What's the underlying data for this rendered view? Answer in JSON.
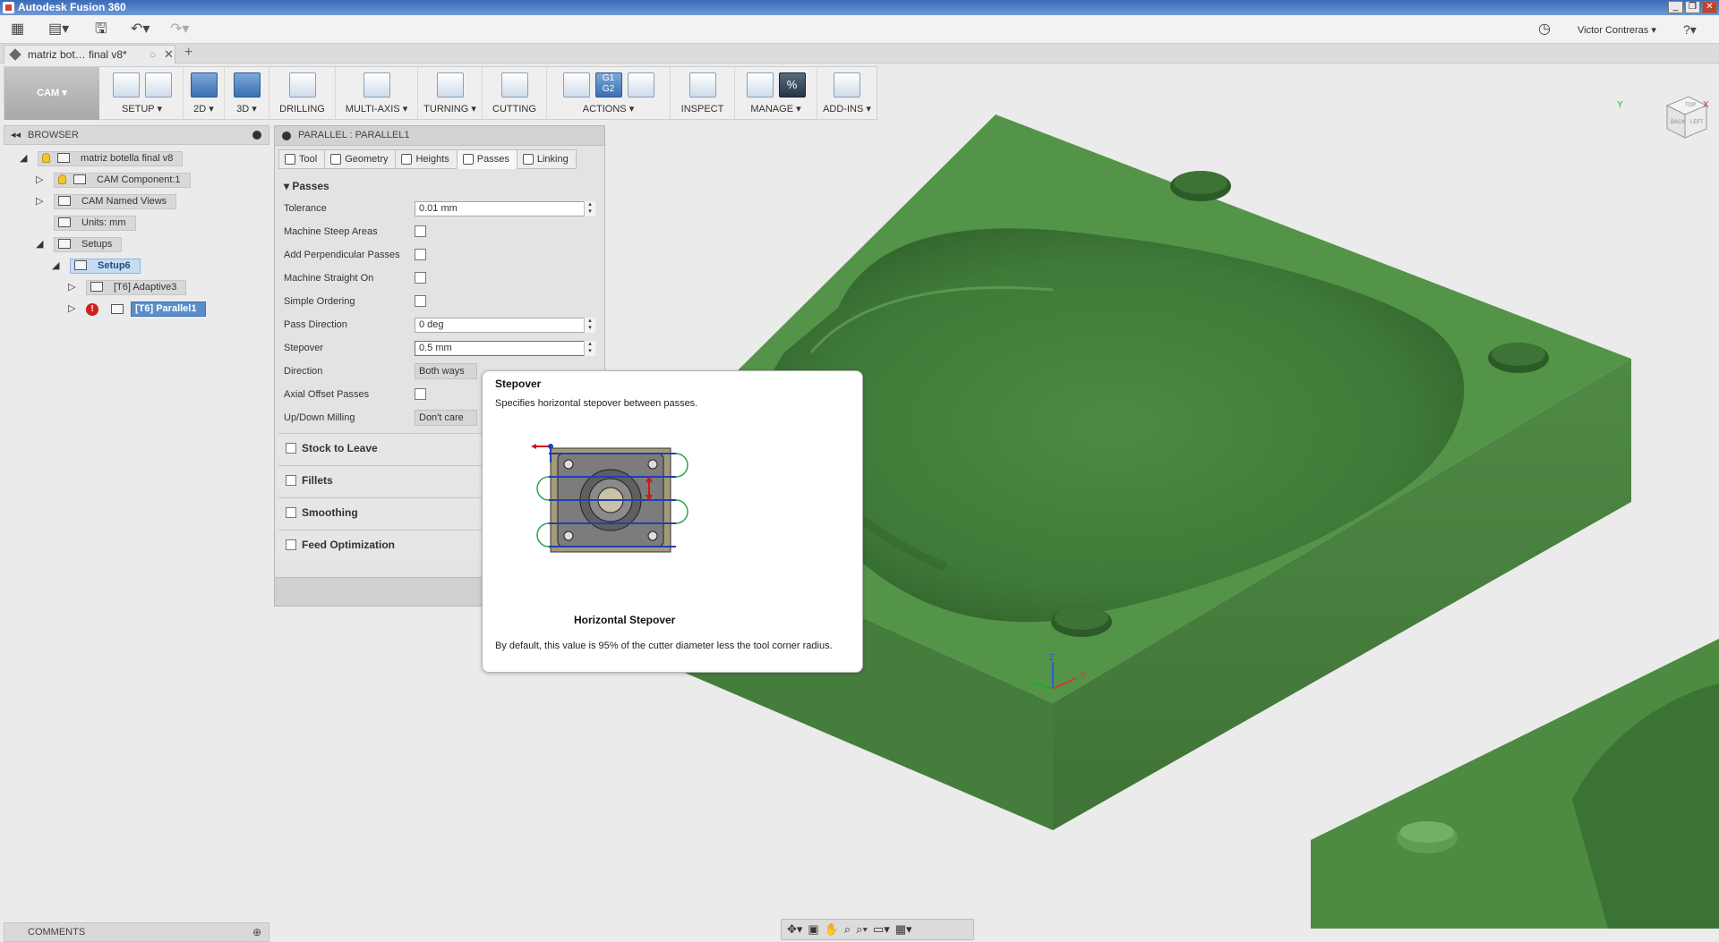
{
  "window": {
    "title": "Autodesk Fusion 360"
  },
  "qat": {
    "user_name": "Victor Contreras",
    "help": "?"
  },
  "document_tab": {
    "title": "matriz bot… final v8*"
  },
  "ribbon": {
    "workspace": "CAM ▾",
    "groups": [
      "SETUP ▾",
      "2D ▾",
      "3D ▾",
      "DRILLING",
      "MULTI-AXIS ▾",
      "TURNING ▾",
      "CUTTING",
      "ACTIONS ▾",
      "INSPECT",
      "MANAGE ▾",
      "ADD-INS ▾"
    ],
    "actions_g1": "G1",
    "actions_g2": "G2",
    "manage_pct": "%"
  },
  "browser": {
    "title": "BROWSER",
    "items": [
      {
        "label": "matriz botella final v8"
      },
      {
        "label": "CAM Component:1"
      },
      {
        "label": "CAM Named Views"
      },
      {
        "label": "Units: mm"
      },
      {
        "label": "Setups"
      },
      {
        "label": "Setup6"
      },
      {
        "label": "[T6] Adaptive3"
      },
      {
        "label": "[T6] Parallel1"
      }
    ]
  },
  "dialog": {
    "title": "PARALLEL : PARALLEL1",
    "tabs": [
      "Tool",
      "Geometry",
      "Heights",
      "Passes",
      "Linking"
    ],
    "section": "Passes",
    "rows": {
      "tolerance_label": "Tolerance",
      "tolerance_value": "0.01 mm",
      "steep_label": "Machine Steep Areas",
      "perp_label": "Add Perpendicular Passes",
      "straight_label": "Machine Straight On",
      "ordering_label": "Simple Ordering",
      "pass_dir_label": "Pass Direction",
      "pass_dir_value": "0 deg",
      "stepover_label": "Stepover",
      "stepover_value": "0.5 mm",
      "direction_label": "Direction",
      "direction_value": "Both ways",
      "axial_label": "Axial Offset Passes",
      "updown_label": "Up/Down Milling",
      "updown_value": "Don't care"
    },
    "groups": [
      "Stock to Leave",
      "Fillets",
      "Smoothing",
      "Feed Optimization"
    ]
  },
  "tooltip": {
    "title": "Stepover",
    "description": "Specifies horizontal stepover between passes.",
    "caption": "Horizontal Stepover",
    "footer": "By default, this value is 95% of the cutter diameter less the tool corner radius."
  },
  "viewcube": {
    "top": "TOP",
    "back": "BACK",
    "left": "LEFT",
    "x": "X",
    "y": "Y"
  },
  "axes": {
    "x": "X",
    "y": "Y",
    "z": "Z"
  },
  "comments": {
    "title": "COMMENTS"
  },
  "colors": {
    "model_green": "#4f8a45",
    "title_blue": "#3a6ab8",
    "selection_blue": "#5b8ec9"
  }
}
